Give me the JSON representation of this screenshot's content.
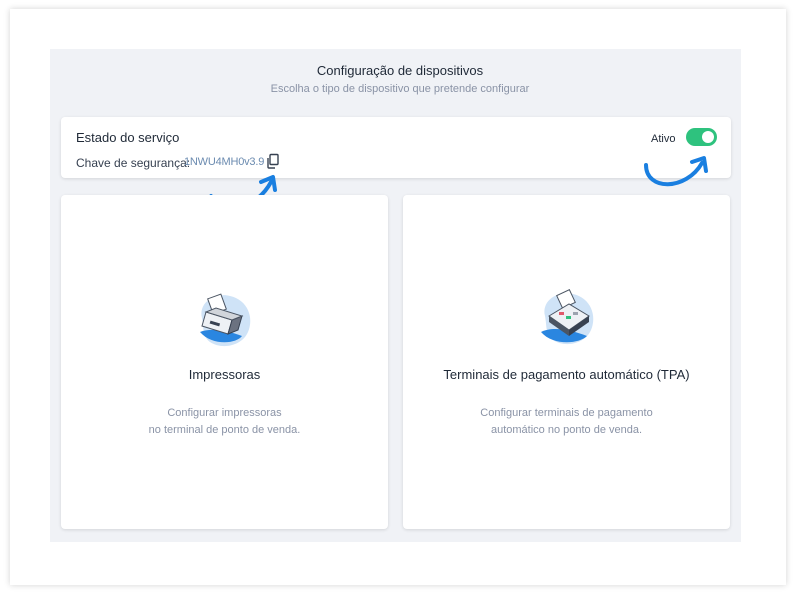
{
  "header": {
    "title": "Configuração de dispositivos",
    "subtitle": "Escolha o tipo de dispositivo que pretende configurar"
  },
  "service": {
    "title": "Estado do serviço",
    "key_label": "Chave de segurança:",
    "key_value": "1NWU4MH0v3.9",
    "copy_icon": "copy-icon",
    "status_label": "Ativo",
    "toggle_on": true,
    "toggle_color": "#2ec27e"
  },
  "devices": [
    {
      "title": "Impressoras",
      "desc_line1": "Configurar impressoras",
      "desc_line2": "no terminal de ponto de venda.",
      "icon": "printer-icon"
    },
    {
      "title": "Terminais de pagamento automático (TPA)",
      "desc_line1": "Configurar terminais de pagamento",
      "desc_line2": "automático no ponto de venda.",
      "icon": "payment-terminal-icon"
    }
  ],
  "colors": {
    "accent_blue": "#1a7fe0",
    "panel_bg": "#f0f2f6",
    "muted_text": "#8a93a6"
  }
}
